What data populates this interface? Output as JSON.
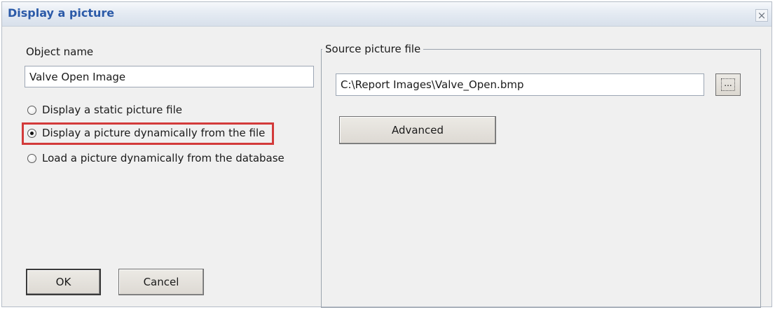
{
  "window": {
    "title": "Display a picture",
    "close_symbol": "×"
  },
  "left_panel": {
    "object_name_label": "Object name",
    "object_name_value": "Valve Open Image",
    "radio_options": [
      {
        "label": "Display a static picture file",
        "checked": false
      },
      {
        "label": "Display a picture dynamically from the file",
        "checked": true
      },
      {
        "label": "Load a picture dynamically from the database",
        "checked": false
      }
    ],
    "highlight_color": "#d33a3a"
  },
  "right_panel": {
    "group_title": "Source picture file",
    "source_path": "C:\\Report Images\\Valve_Open.bmp",
    "browse_label": "...",
    "advanced_label": "Advanced"
  },
  "footer": {
    "ok_label": "OK",
    "cancel_label": "Cancel"
  },
  "icons": {
    "close_icon": "close-icon",
    "browse_icon": "ellipsis-icon"
  }
}
